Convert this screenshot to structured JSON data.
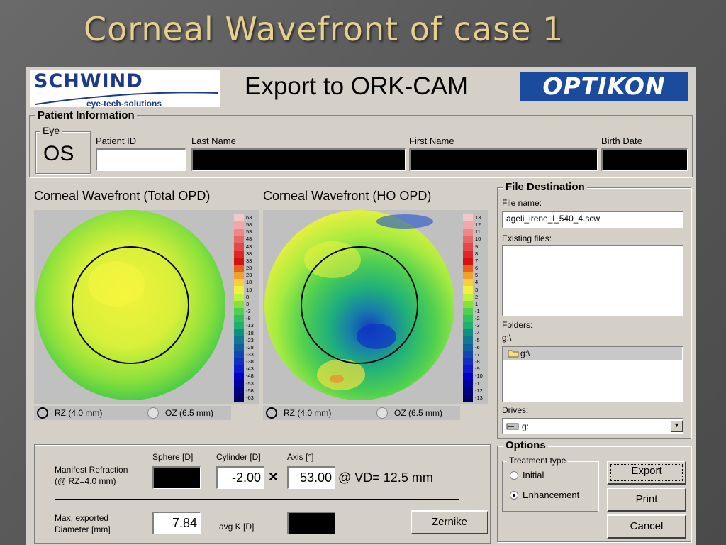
{
  "slide_title": "Corneal Wavefront of case 1",
  "header": {
    "brand_left": "SCHWIND",
    "brand_left_tagline": "eye-tech-solutions",
    "title": "Export to ORK-CAM",
    "brand_right": "OPTIKON"
  },
  "patient": {
    "group_label": "Patient Information",
    "eye_label": "Eye",
    "eye_value": "OS",
    "patient_id_label": "Patient ID",
    "patient_id_value": "",
    "last_name_label": "Last Name",
    "first_name_label": "First Name",
    "birth_date_label": "Birth Date"
  },
  "maps": [
    {
      "title": "Corneal Wavefront (Total OPD)",
      "scale": [
        "63",
        "58",
        "53",
        "48",
        "43",
        "38",
        "33",
        "28",
        "23",
        "18",
        "13",
        "8",
        "3",
        "-3",
        "-8",
        "-13",
        "-18",
        "-23",
        "-28",
        "-33",
        "-38",
        "-43",
        "-48",
        "-53",
        "-58",
        "-63"
      ],
      "legend_rz": "=RZ (4.0 mm)",
      "legend_oz": "=OZ (6.5 mm)"
    },
    {
      "title": "Corneal Wavefront (HO OPD)",
      "scale": [
        "13",
        "12",
        "11",
        "10",
        "9",
        "8",
        "7",
        "6",
        "5",
        "4",
        "3",
        "2",
        "1",
        "-1",
        "-2",
        "-3",
        "-4",
        "-5",
        "-6",
        "-7",
        "-8",
        "-9",
        "-10",
        "-11",
        "-12",
        "-13"
      ],
      "legend_rz": "=RZ (4.0 mm)",
      "legend_oz": "=OZ (6.5 mm)"
    }
  ],
  "scale_colors": [
    "#f4c8c8",
    "#f0a8a8",
    "#ec8888",
    "#e86868",
    "#e44848",
    "#dc2828",
    "#d41010",
    "#e86020",
    "#f0a030",
    "#f4d040",
    "#f0f040",
    "#c0f040",
    "#88e040",
    "#50d050",
    "#30c060",
    "#20b070",
    "#109080",
    "#107890",
    "#1060a0",
    "#1048b0",
    "#1030c0",
    "#1018d0",
    "#0000c8",
    "#0000a0",
    "#000080",
    "#000060"
  ],
  "file_destination": {
    "group_label": "File Destination",
    "file_name_label": "File name:",
    "file_name_value": "ageli_irene_l_540_4.scw",
    "existing_files_label": "Existing files:",
    "folders_label": "Folders:",
    "folders_path": "g:\\",
    "folder_item": "g:\\",
    "drives_label": "Drives:",
    "drive_value": "g:"
  },
  "refraction": {
    "manifest_label_1": "Manifest Refraction",
    "manifest_label_2": "(@ RZ=4.0 mm)",
    "sphere_label": "Sphere [D]",
    "cylinder_label": "Cylinder [D]",
    "cylinder_value": "-2.00",
    "times": "×",
    "axis_label": "Axis [°]",
    "axis_value": "53.00",
    "vd_text": "@ VD= 12.5 mm",
    "max_diam_label_1": "Max. exported",
    "max_diam_label_2": "Diameter [mm]",
    "max_diam_value": "7.84",
    "avgk_label": "avg K [D]",
    "zernike_button": "Zernike"
  },
  "options": {
    "group_label": "Options",
    "treatment_label": "Treatment type",
    "initial_label": "Initial",
    "enhancement_label": "Enhancement",
    "selected": "Enhancement",
    "export_button": "Export",
    "print_button": "Print",
    "cancel_button": "Cancel"
  }
}
